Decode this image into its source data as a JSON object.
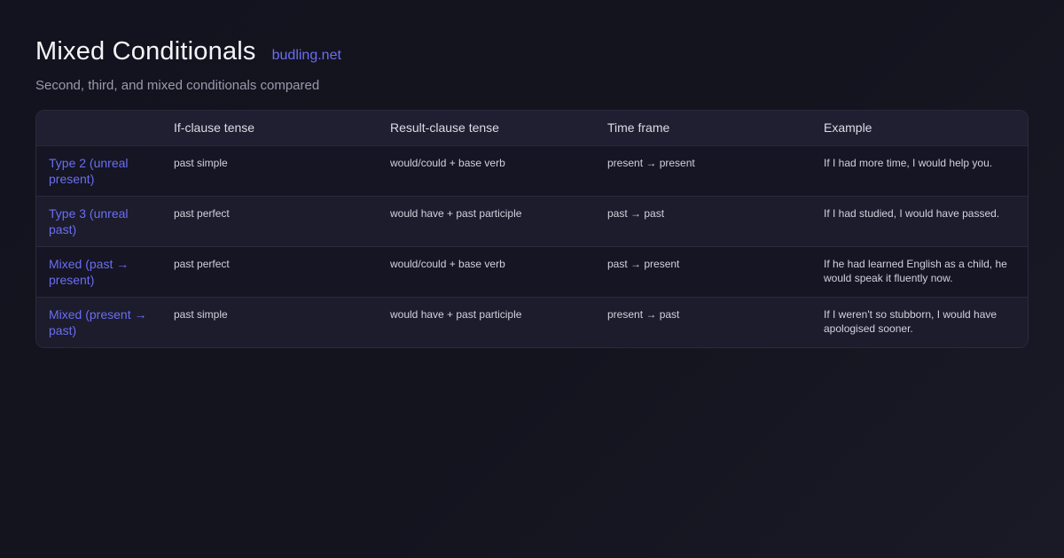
{
  "header": {
    "title": "Mixed Conditionals",
    "site": "budling.net",
    "subtitle": "Second, third, and mixed conditionals compared"
  },
  "table": {
    "columns": [
      "",
      "If-clause tense",
      "Result-clause tense",
      "Time frame",
      "Example"
    ],
    "rows": [
      {
        "type": "Type 2 (unreal present)",
        "if_clause": "past simple",
        "result_clause": "would/could + base verb",
        "time_frame": "present → present",
        "example": "If I had more time, I would help you."
      },
      {
        "type": "Type 3 (unreal past)",
        "if_clause": "past perfect",
        "result_clause": "would have + past participle",
        "time_frame": "past → past",
        "example": "If I had studied, I would have passed."
      },
      {
        "type": "Mixed (past → present)",
        "if_clause": "past perfect",
        "result_clause": "would/could + base verb",
        "time_frame": "past → present",
        "example": "If he had learned English as a child, he would speak it fluently now."
      },
      {
        "type": "Mixed (present → past)",
        "if_clause": "past simple",
        "result_clause": "would have + past participle",
        "time_frame": "present → past",
        "example": "If I weren't so stubborn, I would have apologised sooner."
      }
    ]
  },
  "colors": {
    "accent": "#6b6ef0",
    "background": "#13131f"
  }
}
